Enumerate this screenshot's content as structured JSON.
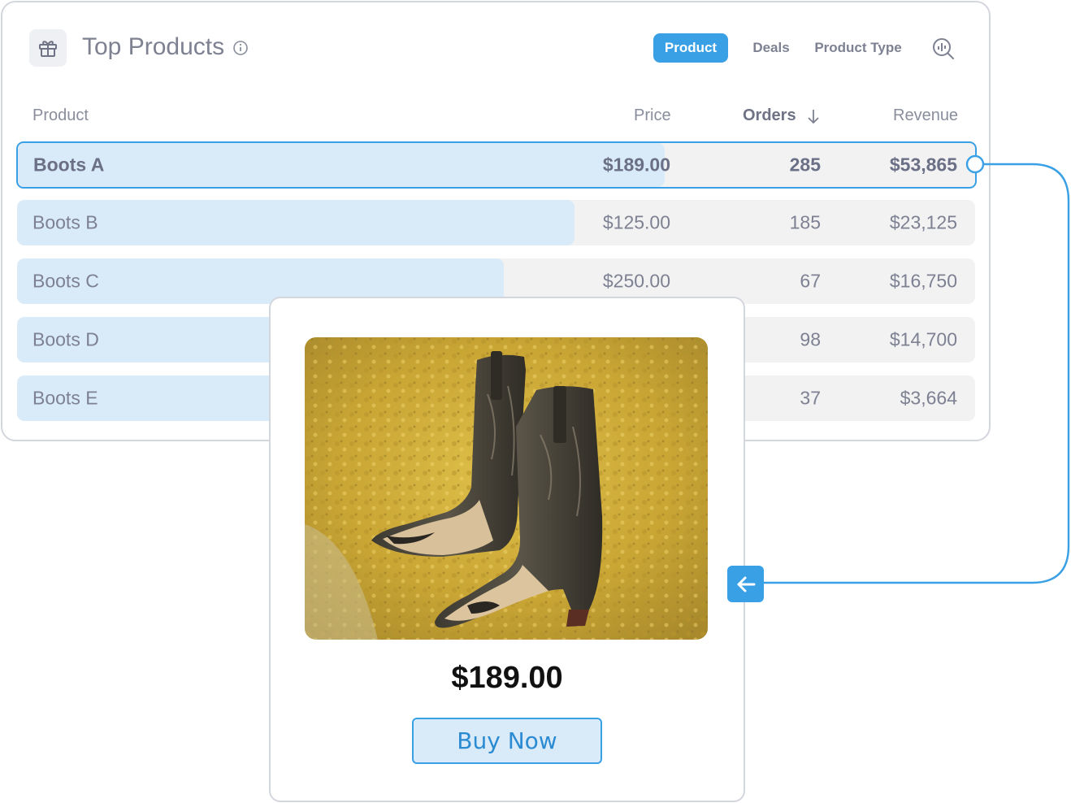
{
  "header": {
    "title": "Top Products",
    "tabs": [
      {
        "label": "Product",
        "active": true
      },
      {
        "label": "Deals",
        "active": false
      },
      {
        "label": "Product Type",
        "active": false
      }
    ]
  },
  "table": {
    "columns": {
      "product": "Product",
      "price": "Price",
      "orders": "Orders",
      "revenue": "Revenue"
    },
    "sort_column": "Orders",
    "sort_direction": "descending",
    "rows": [
      {
        "product": "Boots A",
        "price": "$189.00",
        "orders": "285",
        "revenue": "$53,865",
        "share": 0.675,
        "selected": true
      },
      {
        "product": "Boots B",
        "price": "$125.00",
        "orders": "185",
        "revenue": "$23,125",
        "share": 0.582,
        "selected": false
      },
      {
        "product": "Boots C",
        "price": "$250.00",
        "orders": "67",
        "revenue": "$16,750",
        "share": 0.508,
        "selected": false
      },
      {
        "product": "Boots D",
        "price": "",
        "orders": "98",
        "revenue": "$14,700",
        "share": 0.4,
        "selected": false
      },
      {
        "product": "Boots E",
        "price": "",
        "orders": "37",
        "revenue": "$3,664",
        "share": 0.3,
        "selected": false
      }
    ]
  },
  "popup": {
    "price": "$189.00",
    "buy_label": "Buy Now",
    "image": "cowboy-boots-photo"
  },
  "colors": {
    "accent": "#3aa0e6",
    "bar": "#d9ebf8",
    "row_bg": "#f2f2f3",
    "text": "#7d8191"
  },
  "icons": [
    "gift-icon",
    "info-icon",
    "zoom-analytics-icon",
    "sort-down-icon",
    "arrow-left-icon"
  ]
}
